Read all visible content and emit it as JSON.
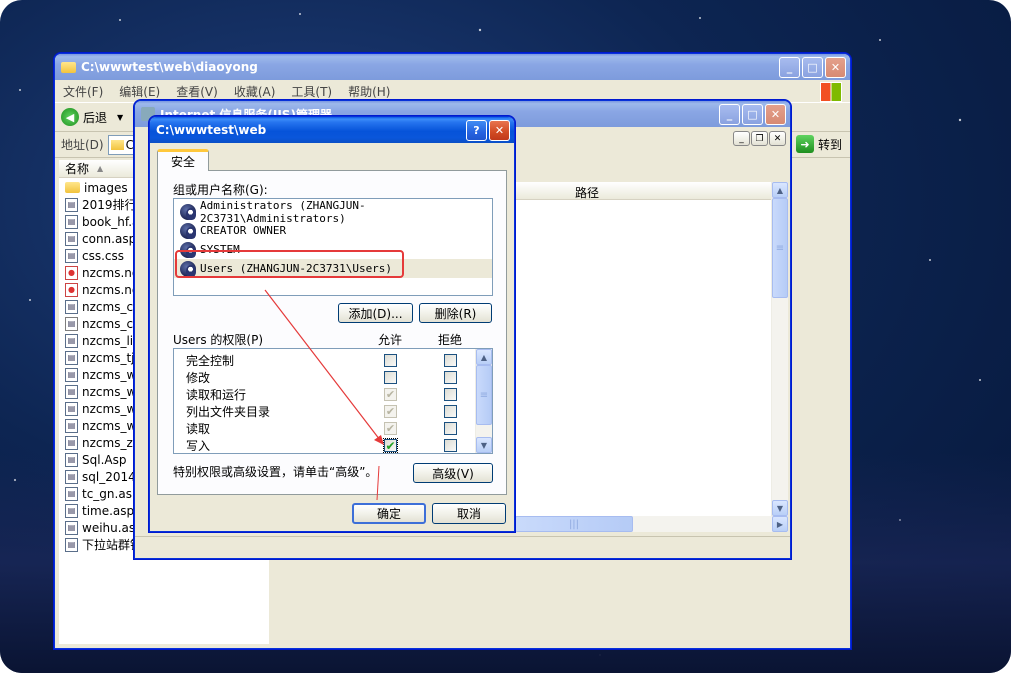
{
  "explorer": {
    "title": "C:\\wwwtest\\web\\diaoyong",
    "menus": [
      "文件(F)",
      "编辑(E)",
      "查看(V)",
      "收藏(A)",
      "工具(T)",
      "帮助(H)"
    ],
    "back_label": "后退",
    "address_label": "地址(D)",
    "address_value": "C",
    "go_label": "转到",
    "column_name": "名称",
    "files": [
      {
        "name": "images",
        "type": "folder"
      },
      {
        "name": "2019排行",
        "type": "asp"
      },
      {
        "name": "book_hf.a",
        "type": "asp"
      },
      {
        "name": "conn.asp",
        "type": "asp"
      },
      {
        "name": "css.css",
        "type": "css"
      },
      {
        "name": "nzcms.noc",
        "type": "html"
      },
      {
        "name": "nzcms.nos",
        "type": "html"
      },
      {
        "name": "nzcms_co",
        "type": "asp"
      },
      {
        "name": "nzcms_co",
        "type": "doc"
      },
      {
        "name": "nzcms_linl",
        "type": "asp"
      },
      {
        "name": "nzcms_tj.",
        "type": "asp"
      },
      {
        "name": "nzcms_we",
        "type": "asp"
      },
      {
        "name": "nzcms_we",
        "type": "asp"
      },
      {
        "name": "nzcms_we",
        "type": "asp"
      },
      {
        "name": "nzcms_we",
        "type": "asp"
      },
      {
        "name": "nzcms_zq",
        "type": "asp"
      },
      {
        "name": "Sql.Asp",
        "type": "asp"
      },
      {
        "name": "sql_2014.",
        "type": "asp"
      },
      {
        "name": "tc_gn.asp",
        "type": "asp"
      },
      {
        "name": "time.asp",
        "type": "asp"
      },
      {
        "name": "weihu.asp",
        "type": "asp"
      },
      {
        "name": "下拉站群锁",
        "type": "asp"
      }
    ]
  },
  "iis": {
    "title": "Internet 信息服务(IIS)管理器",
    "column_path": "路径"
  },
  "dialog": {
    "title": "C:\\wwwtest\\web",
    "help_btn": "?",
    "tab_security": "安全",
    "group_label": "组或用户名称(G):",
    "users": [
      {
        "name": "Administrators (ZHANGJUN-2C3731\\Administrators)"
      },
      {
        "name": "CREATOR OWNER"
      },
      {
        "name": "SYSTEM"
      },
      {
        "name": "Users (ZHANGJUN-2C3731\\Users)"
      }
    ],
    "add_button": "添加(D)...",
    "remove_button": "删除(R)",
    "perm_label": "Users 的权限(P)",
    "allow_label": "允许",
    "deny_label": "拒绝",
    "permissions": [
      {
        "name": "完全控制",
        "allow": false,
        "allow_disabled": false,
        "deny": false
      },
      {
        "name": "修改",
        "allow": false,
        "allow_disabled": false,
        "deny": false
      },
      {
        "name": "读取和运行",
        "allow": true,
        "allow_disabled": true,
        "deny": false
      },
      {
        "name": "列出文件夹目录",
        "allow": true,
        "allow_disabled": true,
        "deny": false
      },
      {
        "name": "读取",
        "allow": true,
        "allow_disabled": true,
        "deny": false
      },
      {
        "name": "写入",
        "allow": true,
        "allow_disabled": false,
        "deny": false
      }
    ],
    "advanced_hint": "特别权限或高级设置，请单击“高级”。",
    "advanced_button": "高级(V)",
    "ok_button": "确定",
    "cancel_button": "取消"
  },
  "colors": {
    "titlebar": "#0653d9",
    "annotation": "#e53a3a",
    "window_bg": "#ece9d8"
  }
}
